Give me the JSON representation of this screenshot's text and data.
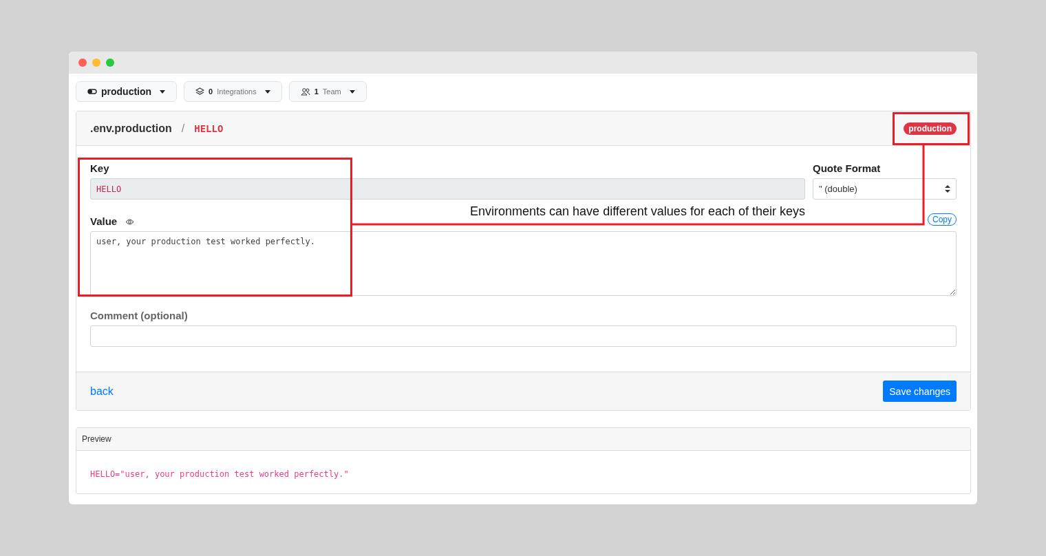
{
  "toolbar": [
    {
      "kind": "environment",
      "label": "production"
    },
    {
      "kind": "integrations",
      "count": "0",
      "label": "Integrations"
    },
    {
      "kind": "team",
      "count": "1",
      "label": "Team"
    }
  ],
  "header": {
    "file": ".env.production",
    "separator": "/",
    "key": "HELLO",
    "badge": "production"
  },
  "form": {
    "key_label": "Key",
    "key_value": "HELLO",
    "quote_label": "Quote Format",
    "quote_value": "\" (double)",
    "value_label": "Value",
    "copy": "Copy",
    "value": "user, your production test worked perfectly.",
    "comment_label": "Comment (optional)"
  },
  "footer": {
    "back": "back",
    "save": "Save changes"
  },
  "preview": {
    "title": "Preview",
    "code": "HELLO=\"user, your production test worked perfectly.\""
  },
  "annotation": {
    "caption": "Environments can have different values for each of their keys"
  }
}
